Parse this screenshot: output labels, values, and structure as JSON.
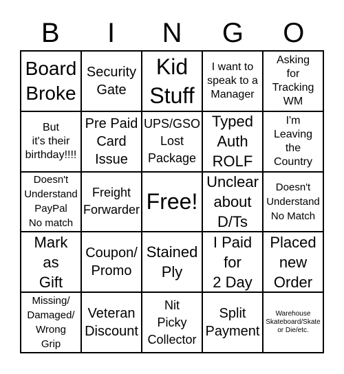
{
  "header": [
    "B",
    "I",
    "N",
    "G",
    "O"
  ],
  "cells": [
    "Board\nBroke",
    "Security\nGate",
    "Kid\nStuff",
    "I want to\nspeak to a\nManager",
    "Asking\nfor\nTracking\nWM",
    "But\nit's their\nbirthday!!!!",
    "Pre Paid\nCard\nIssue",
    "UPS/GSO\nLost\nPackage",
    "Typed\nAuth\nROLF",
    "I'm\nLeaving\nthe\nCountry",
    "Doesn't\nUnderstand\nPayPal\nNo match",
    "Freight\nForwarder",
    "Free!",
    "Unclear\nabout\nD/Ts",
    "Doesn't\nUnderstand\nNo Match",
    "Mark\nas\nGift",
    "Coupon/\nPromo",
    "Stained\nPly",
    "I Paid\nfor\n2 Day",
    "Placed\nnew\nOrder",
    "Missing/\nDamaged/\nWrong\nGrip",
    "Veteran\nDiscount",
    "Nit\nPicky\nCollector",
    "Split\nPayment",
    "Warehouse\nSkateboard/Skate\nor Die/etc."
  ]
}
